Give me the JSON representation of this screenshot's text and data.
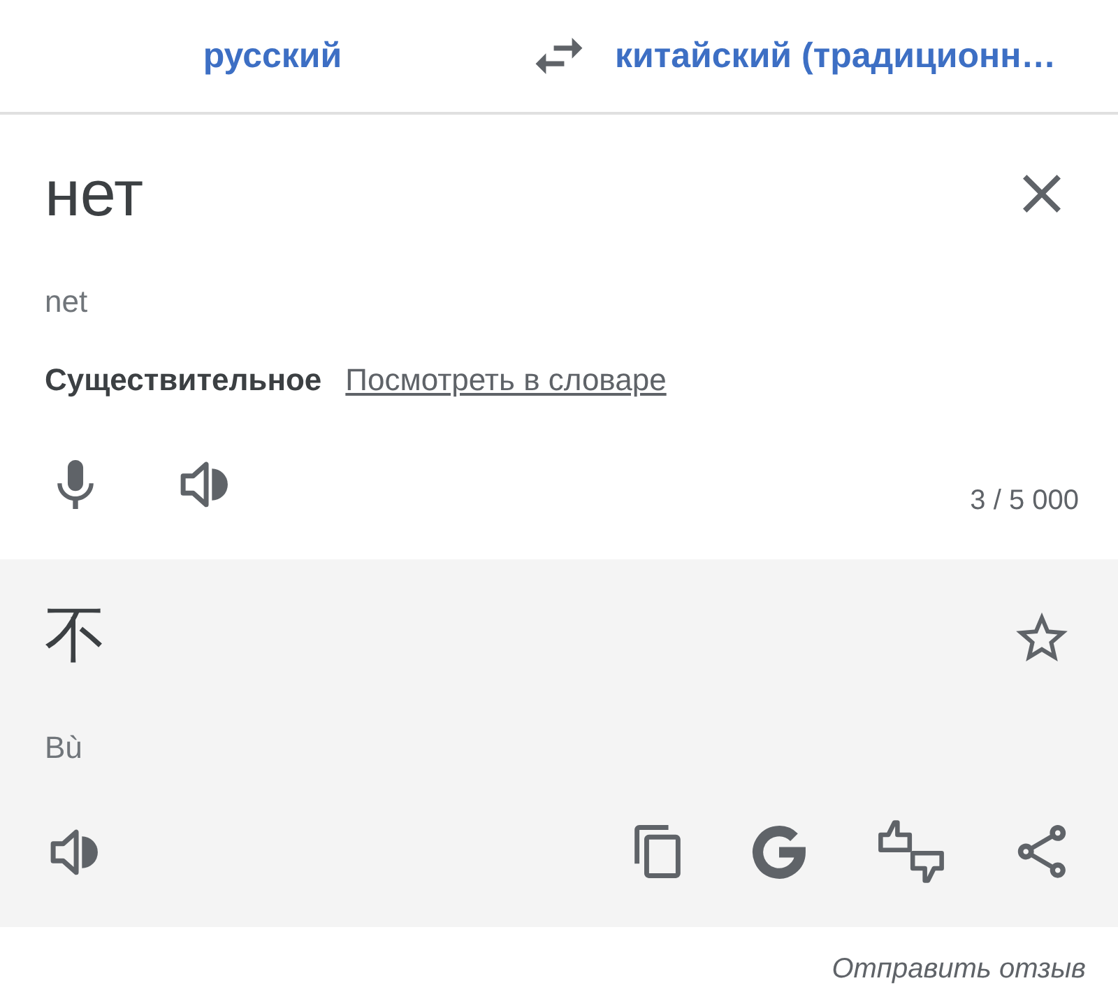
{
  "language_bar": {
    "source_language": "русский",
    "target_language": "китайский (традиционн…"
  },
  "source": {
    "text": "нет",
    "transliteration": "net",
    "part_of_speech": "Существительное",
    "dictionary_link": "Посмотреть в словаре",
    "char_count": "3 / 5 000"
  },
  "translation": {
    "text": "不",
    "transliteration": "Bù",
    "starred": false
  },
  "feedback_link": "Отправить отзыв"
}
